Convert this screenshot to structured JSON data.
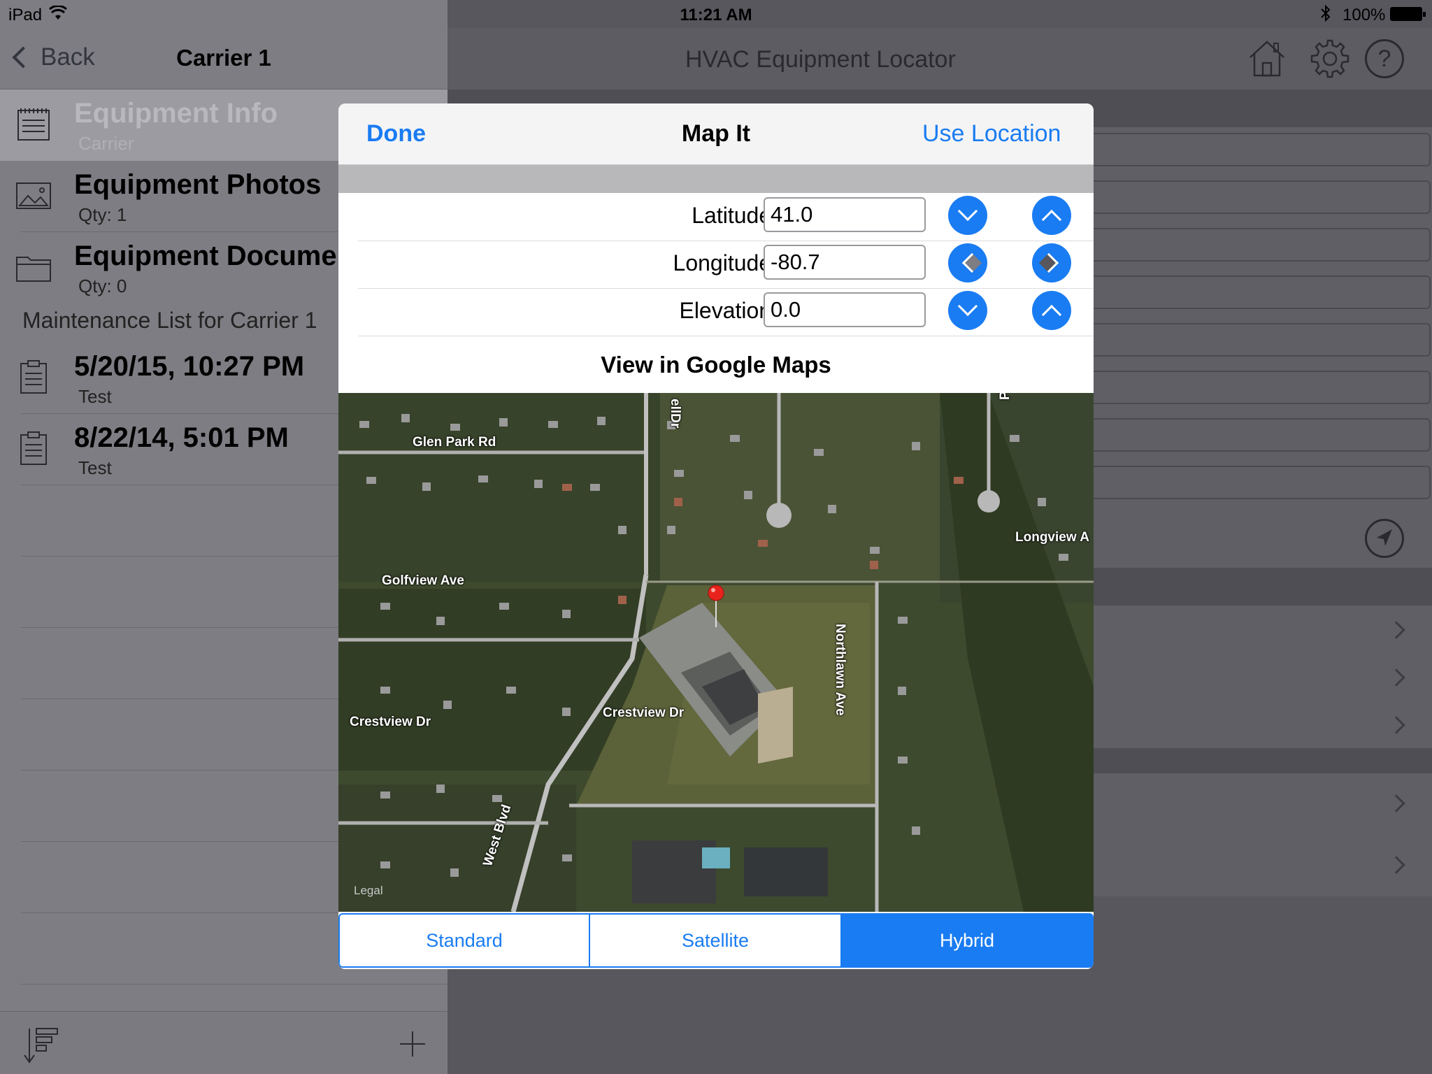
{
  "status": {
    "device": "iPad",
    "time": "11:21 AM",
    "battery": "100%"
  },
  "master": {
    "back_label": "Back",
    "title": "Carrier 1",
    "rows": [
      {
        "title": "Equipment Info",
        "sub": "Carrier"
      },
      {
        "title": "Equipment Photos",
        "sub": "Qty: 1"
      },
      {
        "title": "Equipment Documer",
        "sub": "Qty: 0"
      }
    ],
    "section_header": "Maintenance List for Carrier 1",
    "maintenance": [
      {
        "title": "5/20/15, 10:27 PM",
        "sub": "Test"
      },
      {
        "title": "8/22/14, 5:01 PM",
        "sub": "Test"
      }
    ]
  },
  "detail": {
    "title": "HVAC Equipment Locator",
    "help_glyph": "?"
  },
  "modal": {
    "done_label": "Done",
    "title": "Map It",
    "use_location_label": "Use Location",
    "latitude_label": "Latitude:",
    "latitude_value": "41.0",
    "longitude_label": "Longitude:",
    "longitude_value": "-80.7",
    "elevation_label": "Elevation:",
    "elevation_value": "0.0",
    "google_maps_label": "View in Google Maps",
    "map": {
      "roads": [
        "Glen Park Rd",
        "Golfview Ave",
        "Crestview Dr",
        "Crestview Dr",
        "West Blvd",
        "Northlawn Ave",
        "Longview A",
        "Parkland A",
        "ellDr"
      ],
      "legal": "Legal"
    },
    "map_types": [
      "Standard",
      "Satellite",
      "Hybrid"
    ],
    "selected_map_type": "Hybrid"
  },
  "colors": {
    "accent": "#1a7cf2",
    "pin": "#e8231d"
  }
}
